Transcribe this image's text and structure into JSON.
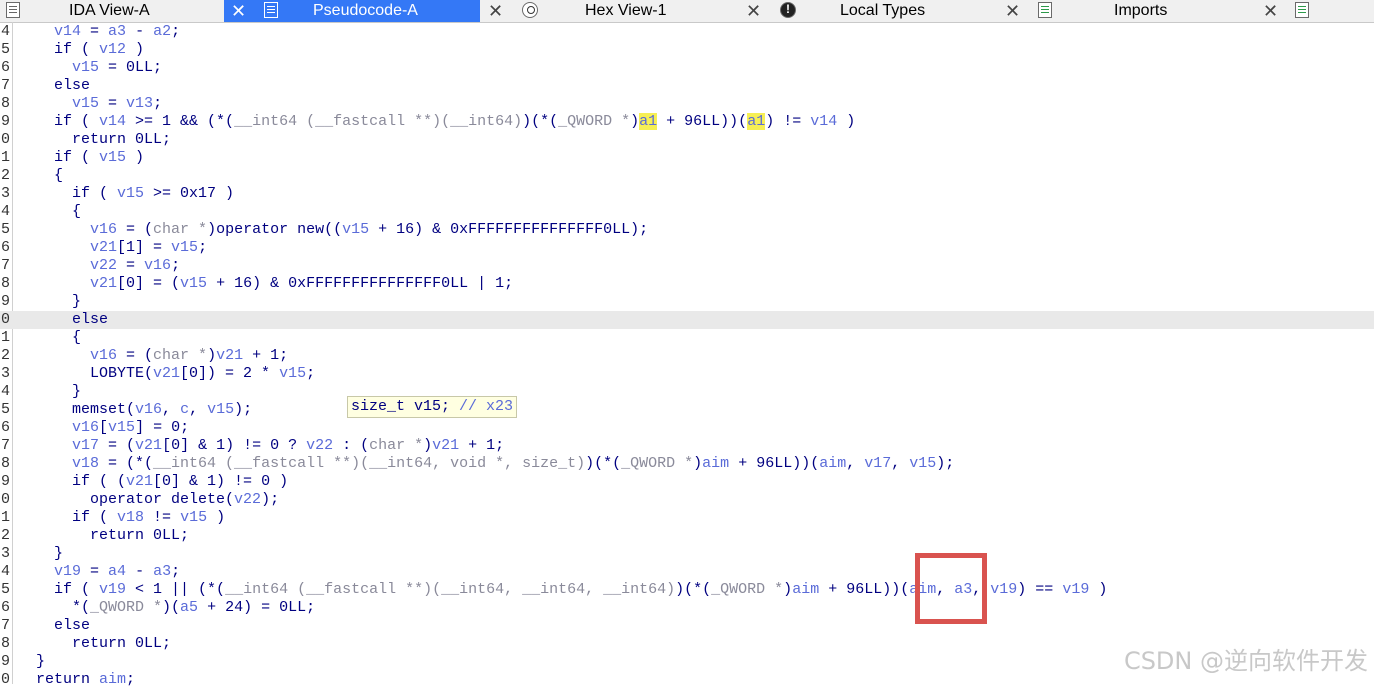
{
  "tabs": [
    {
      "label": "IDA View-A",
      "icon": "disassembly-icon",
      "active": false
    },
    {
      "label": "Pseudocode-A",
      "icon": "pseudocode-icon",
      "active": true
    },
    {
      "label": "Hex View-1",
      "icon": "hex-icon",
      "active": false
    },
    {
      "label": "Local Types",
      "icon": "info-icon",
      "active": false
    },
    {
      "label": "Imports",
      "icon": "imports-icon",
      "active": false
    }
  ],
  "close_glyph": "✕",
  "code": {
    "current_line_index": 16,
    "lines": [
      {
        "num": "4",
        "tokens": [
          [
            "    ",
            "k"
          ],
          [
            "v14",
            "v"
          ],
          [
            " = ",
            "k"
          ],
          [
            "a3",
            "v"
          ],
          [
            " - ",
            "k"
          ],
          [
            "a2",
            "v"
          ],
          [
            ";",
            "k"
          ]
        ]
      },
      {
        "num": "5",
        "tokens": [
          [
            "    if ( ",
            "k"
          ],
          [
            "v12",
            "v"
          ],
          [
            " )",
            "k"
          ]
        ]
      },
      {
        "num": "6",
        "tokens": [
          [
            "      ",
            "k"
          ],
          [
            "v15",
            "v"
          ],
          [
            " = 0LL;",
            "k"
          ]
        ]
      },
      {
        "num": "7",
        "tokens": [
          [
            "    else",
            "k"
          ]
        ]
      },
      {
        "num": "8",
        "tokens": [
          [
            "      ",
            "k"
          ],
          [
            "v15",
            "v"
          ],
          [
            " = ",
            "k"
          ],
          [
            "v13",
            "v"
          ],
          [
            ";",
            "k"
          ]
        ]
      },
      {
        "num": "9",
        "tokens": [
          [
            "    if ( ",
            "k"
          ],
          [
            "v14",
            "v"
          ],
          [
            " >= 1 && (*(",
            "k"
          ],
          [
            "__int64 (__fastcall **)(__int64)",
            "t"
          ],
          [
            ")(*(",
            "k"
          ],
          [
            "_QWORD *",
            "t"
          ],
          [
            ")",
            "k"
          ],
          [
            "a1",
            "h"
          ],
          [
            " + 96LL))(",
            "k"
          ],
          [
            "a1",
            "h"
          ],
          [
            ") != ",
            "k"
          ],
          [
            "v14",
            "v"
          ],
          [
            " )",
            "k"
          ]
        ]
      },
      {
        "num": "0",
        "tokens": [
          [
            "      return 0LL;",
            "k"
          ]
        ]
      },
      {
        "num": "1",
        "tokens": [
          [
            "    if ( ",
            "k"
          ],
          [
            "v15",
            "v"
          ],
          [
            " )",
            "k"
          ]
        ]
      },
      {
        "num": "2",
        "tokens": [
          [
            "    {",
            "k"
          ]
        ]
      },
      {
        "num": "3",
        "tokens": [
          [
            "      if ( ",
            "k"
          ],
          [
            "v15",
            "v"
          ],
          [
            " >= 0x17 )",
            "k"
          ]
        ]
      },
      {
        "num": "4",
        "tokens": [
          [
            "      {",
            "k"
          ]
        ]
      },
      {
        "num": "5",
        "tokens": [
          [
            "        ",
            "k"
          ],
          [
            "v16",
            "v"
          ],
          [
            " = (",
            "k"
          ],
          [
            "char *",
            "t"
          ],
          [
            ")operator new((",
            "k"
          ],
          [
            "v15",
            "v"
          ],
          [
            " + 16) & 0xFFFFFFFFFFFFFFF0LL);",
            "k"
          ]
        ]
      },
      {
        "num": "6",
        "tokens": [
          [
            "        ",
            "k"
          ],
          [
            "v21",
            "v"
          ],
          [
            "[1] = ",
            "k"
          ],
          [
            "v15",
            "v"
          ],
          [
            ";",
            "k"
          ]
        ]
      },
      {
        "num": "7",
        "tokens": [
          [
            "        ",
            "k"
          ],
          [
            "v22",
            "v"
          ],
          [
            " = ",
            "k"
          ],
          [
            "v16",
            "v"
          ],
          [
            ";",
            "k"
          ]
        ]
      },
      {
        "num": "8",
        "tokens": [
          [
            "        ",
            "k"
          ],
          [
            "v21",
            "v"
          ],
          [
            "[0] = (",
            "k"
          ],
          [
            "v15",
            "v"
          ],
          [
            " + 16) & 0xFFFFFFFFFFFFFFF0LL | 1;",
            "k"
          ]
        ]
      },
      {
        "num": "9",
        "tokens": [
          [
            "      }",
            "k"
          ]
        ]
      },
      {
        "num": "0",
        "tokens": [
          [
            "      else",
            "k"
          ]
        ]
      },
      {
        "num": "1",
        "tokens": [
          [
            "      {",
            "k"
          ]
        ]
      },
      {
        "num": "2",
        "tokens": [
          [
            "        ",
            "k"
          ],
          [
            "v16",
            "v"
          ],
          [
            " = (",
            "k"
          ],
          [
            "char *",
            "t"
          ],
          [
            ")",
            "k"
          ],
          [
            "v21",
            "v"
          ],
          [
            " + 1;",
            "k"
          ]
        ]
      },
      {
        "num": "3",
        "tokens": [
          [
            "        LOBYTE(",
            "k"
          ],
          [
            "v21",
            "v"
          ],
          [
            "[0]) = 2 * ",
            "k"
          ],
          [
            "v15",
            "v"
          ],
          [
            ";",
            "k"
          ]
        ]
      },
      {
        "num": "4",
        "tokens": [
          [
            "      }",
            "k"
          ]
        ]
      },
      {
        "num": "5",
        "tokens": [
          [
            "      memset(",
            "k"
          ],
          [
            "v16",
            "v"
          ],
          [
            ", ",
            "k"
          ],
          [
            "c",
            "v"
          ],
          [
            ", ",
            "k"
          ],
          [
            "v15",
            "v"
          ],
          [
            ");",
            "k"
          ]
        ]
      },
      {
        "num": "6",
        "tokens": [
          [
            "      ",
            "k"
          ],
          [
            "v16",
            "v"
          ],
          [
            "[",
            "k"
          ],
          [
            "v15",
            "v"
          ],
          [
            "] = 0;",
            "k"
          ]
        ]
      },
      {
        "num": "7",
        "tokens": [
          [
            "      ",
            "k"
          ],
          [
            "v17",
            "v"
          ],
          [
            " = (",
            "k"
          ],
          [
            "v21",
            "v"
          ],
          [
            "[0] & 1) != 0 ? ",
            "k"
          ],
          [
            "v22",
            "v"
          ],
          [
            " : (",
            "k"
          ],
          [
            "char *",
            "t"
          ],
          [
            ")",
            "k"
          ],
          [
            "v21",
            "v"
          ],
          [
            " + 1;",
            "k"
          ]
        ]
      },
      {
        "num": "8",
        "tokens": [
          [
            "      ",
            "k"
          ],
          [
            "v18",
            "v"
          ],
          [
            " = (*(",
            "k"
          ],
          [
            "__int64 (__fastcall **)(__int64, void *, size_t)",
            "t"
          ],
          [
            ")(*(",
            "k"
          ],
          [
            "_QWORD *",
            "t"
          ],
          [
            ")",
            "k"
          ],
          [
            "aim",
            "v"
          ],
          [
            " + 96LL))(",
            "k"
          ],
          [
            "aim",
            "v"
          ],
          [
            ", ",
            "k"
          ],
          [
            "v17",
            "v"
          ],
          [
            ", ",
            "k"
          ],
          [
            "v15",
            "v"
          ],
          [
            ");",
            "k"
          ]
        ]
      },
      {
        "num": "9",
        "tokens": [
          [
            "      if ( (",
            "k"
          ],
          [
            "v21",
            "v"
          ],
          [
            "[0] & 1) != 0 )",
            "k"
          ]
        ]
      },
      {
        "num": "0",
        "tokens": [
          [
            "        operator delete(",
            "k"
          ],
          [
            "v22",
            "v"
          ],
          [
            ");",
            "k"
          ]
        ]
      },
      {
        "num": "1",
        "tokens": [
          [
            "      if ( ",
            "k"
          ],
          [
            "v18",
            "v"
          ],
          [
            " != ",
            "k"
          ],
          [
            "v15",
            "v"
          ],
          [
            " )",
            "k"
          ]
        ]
      },
      {
        "num": "2",
        "tokens": [
          [
            "        return 0LL;",
            "k"
          ]
        ]
      },
      {
        "num": "3",
        "tokens": [
          [
            "    }",
            "k"
          ]
        ]
      },
      {
        "num": "4",
        "tokens": [
          [
            "    ",
            "k"
          ],
          [
            "v19",
            "v"
          ],
          [
            " = ",
            "k"
          ],
          [
            "a4",
            "v"
          ],
          [
            " - ",
            "k"
          ],
          [
            "a3",
            "v"
          ],
          [
            ";",
            "k"
          ]
        ]
      },
      {
        "num": "5",
        "tokens": [
          [
            "    if ( ",
            "k"
          ],
          [
            "v19",
            "v"
          ],
          [
            " < 1 || (*(",
            "k"
          ],
          [
            "__int64 (__fastcall **)(__int64, __int64, __int64)",
            "t"
          ],
          [
            ")(*(",
            "k"
          ],
          [
            "_QWORD *",
            "t"
          ],
          [
            ")",
            "k"
          ],
          [
            "aim",
            "v"
          ],
          [
            " + 96LL))(",
            "k"
          ],
          [
            "aim",
            "v"
          ],
          [
            ", ",
            "k"
          ],
          [
            "a3",
            "v"
          ],
          [
            ", ",
            "k"
          ],
          [
            "v19",
            "v"
          ],
          [
            ") == ",
            "k"
          ],
          [
            "v19",
            "v"
          ],
          [
            " )",
            "k"
          ]
        ]
      },
      {
        "num": "6",
        "tokens": [
          [
            "      *(",
            "k"
          ],
          [
            "_QWORD *",
            "t"
          ],
          [
            ")(",
            "k"
          ],
          [
            "a5",
            "v"
          ],
          [
            " + 24) = 0LL;",
            "k"
          ]
        ]
      },
      {
        "num": "7",
        "tokens": [
          [
            "    else",
            "k"
          ]
        ]
      },
      {
        "num": "8",
        "tokens": [
          [
            "      return 0LL;",
            "k"
          ]
        ]
      },
      {
        "num": "9",
        "tokens": [
          [
            "  }",
            "k"
          ]
        ]
      },
      {
        "num": "0",
        "tokens": [
          [
            "  return ",
            "k"
          ],
          [
            "aim",
            "v"
          ],
          [
            ";",
            "k"
          ]
        ]
      }
    ]
  },
  "tooltip": {
    "decl": "size_t v15; ",
    "comment": "// x23"
  },
  "watermark": "CSDN @逆向软件开发"
}
